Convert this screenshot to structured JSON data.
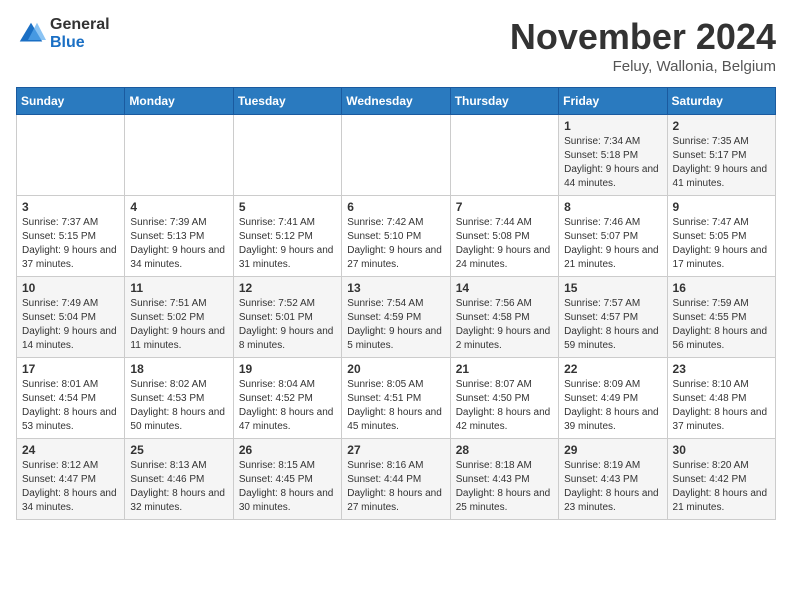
{
  "logo": {
    "general": "General",
    "blue": "Blue"
  },
  "title": "November 2024",
  "location": "Feluy, Wallonia, Belgium",
  "days_of_week": [
    "Sunday",
    "Monday",
    "Tuesday",
    "Wednesday",
    "Thursday",
    "Friday",
    "Saturday"
  ],
  "weeks": [
    [
      {
        "day": "",
        "info": ""
      },
      {
        "day": "",
        "info": ""
      },
      {
        "day": "",
        "info": ""
      },
      {
        "day": "",
        "info": ""
      },
      {
        "day": "",
        "info": ""
      },
      {
        "day": "1",
        "info": "Sunrise: 7:34 AM\nSunset: 5:18 PM\nDaylight: 9 hours and 44 minutes."
      },
      {
        "day": "2",
        "info": "Sunrise: 7:35 AM\nSunset: 5:17 PM\nDaylight: 9 hours and 41 minutes."
      }
    ],
    [
      {
        "day": "3",
        "info": "Sunrise: 7:37 AM\nSunset: 5:15 PM\nDaylight: 9 hours and 37 minutes."
      },
      {
        "day": "4",
        "info": "Sunrise: 7:39 AM\nSunset: 5:13 PM\nDaylight: 9 hours and 34 minutes."
      },
      {
        "day": "5",
        "info": "Sunrise: 7:41 AM\nSunset: 5:12 PM\nDaylight: 9 hours and 31 minutes."
      },
      {
        "day": "6",
        "info": "Sunrise: 7:42 AM\nSunset: 5:10 PM\nDaylight: 9 hours and 27 minutes."
      },
      {
        "day": "7",
        "info": "Sunrise: 7:44 AM\nSunset: 5:08 PM\nDaylight: 9 hours and 24 minutes."
      },
      {
        "day": "8",
        "info": "Sunrise: 7:46 AM\nSunset: 5:07 PM\nDaylight: 9 hours and 21 minutes."
      },
      {
        "day": "9",
        "info": "Sunrise: 7:47 AM\nSunset: 5:05 PM\nDaylight: 9 hours and 17 minutes."
      }
    ],
    [
      {
        "day": "10",
        "info": "Sunrise: 7:49 AM\nSunset: 5:04 PM\nDaylight: 9 hours and 14 minutes."
      },
      {
        "day": "11",
        "info": "Sunrise: 7:51 AM\nSunset: 5:02 PM\nDaylight: 9 hours and 11 minutes."
      },
      {
        "day": "12",
        "info": "Sunrise: 7:52 AM\nSunset: 5:01 PM\nDaylight: 9 hours and 8 minutes."
      },
      {
        "day": "13",
        "info": "Sunrise: 7:54 AM\nSunset: 4:59 PM\nDaylight: 9 hours and 5 minutes."
      },
      {
        "day": "14",
        "info": "Sunrise: 7:56 AM\nSunset: 4:58 PM\nDaylight: 9 hours and 2 minutes."
      },
      {
        "day": "15",
        "info": "Sunrise: 7:57 AM\nSunset: 4:57 PM\nDaylight: 8 hours and 59 minutes."
      },
      {
        "day": "16",
        "info": "Sunrise: 7:59 AM\nSunset: 4:55 PM\nDaylight: 8 hours and 56 minutes."
      }
    ],
    [
      {
        "day": "17",
        "info": "Sunrise: 8:01 AM\nSunset: 4:54 PM\nDaylight: 8 hours and 53 minutes."
      },
      {
        "day": "18",
        "info": "Sunrise: 8:02 AM\nSunset: 4:53 PM\nDaylight: 8 hours and 50 minutes."
      },
      {
        "day": "19",
        "info": "Sunrise: 8:04 AM\nSunset: 4:52 PM\nDaylight: 8 hours and 47 minutes."
      },
      {
        "day": "20",
        "info": "Sunrise: 8:05 AM\nSunset: 4:51 PM\nDaylight: 8 hours and 45 minutes."
      },
      {
        "day": "21",
        "info": "Sunrise: 8:07 AM\nSunset: 4:50 PM\nDaylight: 8 hours and 42 minutes."
      },
      {
        "day": "22",
        "info": "Sunrise: 8:09 AM\nSunset: 4:49 PM\nDaylight: 8 hours and 39 minutes."
      },
      {
        "day": "23",
        "info": "Sunrise: 8:10 AM\nSunset: 4:48 PM\nDaylight: 8 hours and 37 minutes."
      }
    ],
    [
      {
        "day": "24",
        "info": "Sunrise: 8:12 AM\nSunset: 4:47 PM\nDaylight: 8 hours and 34 minutes."
      },
      {
        "day": "25",
        "info": "Sunrise: 8:13 AM\nSunset: 4:46 PM\nDaylight: 8 hours and 32 minutes."
      },
      {
        "day": "26",
        "info": "Sunrise: 8:15 AM\nSunset: 4:45 PM\nDaylight: 8 hours and 30 minutes."
      },
      {
        "day": "27",
        "info": "Sunrise: 8:16 AM\nSunset: 4:44 PM\nDaylight: 8 hours and 27 minutes."
      },
      {
        "day": "28",
        "info": "Sunrise: 8:18 AM\nSunset: 4:43 PM\nDaylight: 8 hours and 25 minutes."
      },
      {
        "day": "29",
        "info": "Sunrise: 8:19 AM\nSunset: 4:43 PM\nDaylight: 8 hours and 23 minutes."
      },
      {
        "day": "30",
        "info": "Sunrise: 8:20 AM\nSunset: 4:42 PM\nDaylight: 8 hours and 21 minutes."
      }
    ]
  ]
}
